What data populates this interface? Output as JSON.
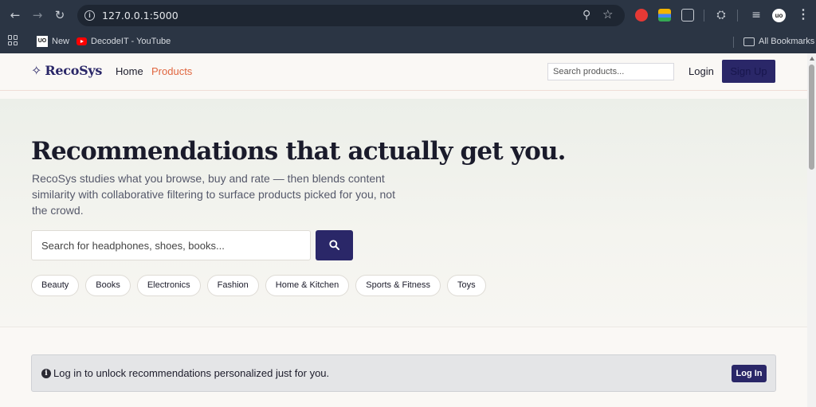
{
  "browser": {
    "url": "127.0.0.1:5000",
    "bookmarks": [
      {
        "label": "New"
      },
      {
        "label": "DecodeIT - YouTube"
      }
    ],
    "all_bookmarks_label": "All Bookmarks",
    "profile_initials": "uo"
  },
  "header": {
    "brand": "RecoSys",
    "nav": {
      "home": "Home",
      "products": "Products"
    },
    "search_placeholder": "Search products...",
    "login": "Login",
    "signup": "Sign Up"
  },
  "hero": {
    "title": "Recommendations that actually get you.",
    "description": "RecoSys studies what you browse, buy and rate — then blends content similarity with collaborative filtering to surface products picked for you, not the crowd.",
    "search_placeholder": "Search for headphones, shoes, books...",
    "categories": [
      "Beauty",
      "Books",
      "Electronics",
      "Fashion",
      "Home & Kitchen",
      "Sports & Fitness",
      "Toys"
    ]
  },
  "alert": {
    "message": "Log in to unlock recommendations personalized just for you.",
    "button": "Log In"
  },
  "colors": {
    "brand": "#2a2768",
    "accent": "#e0663f",
    "background": "#faf8f5"
  }
}
